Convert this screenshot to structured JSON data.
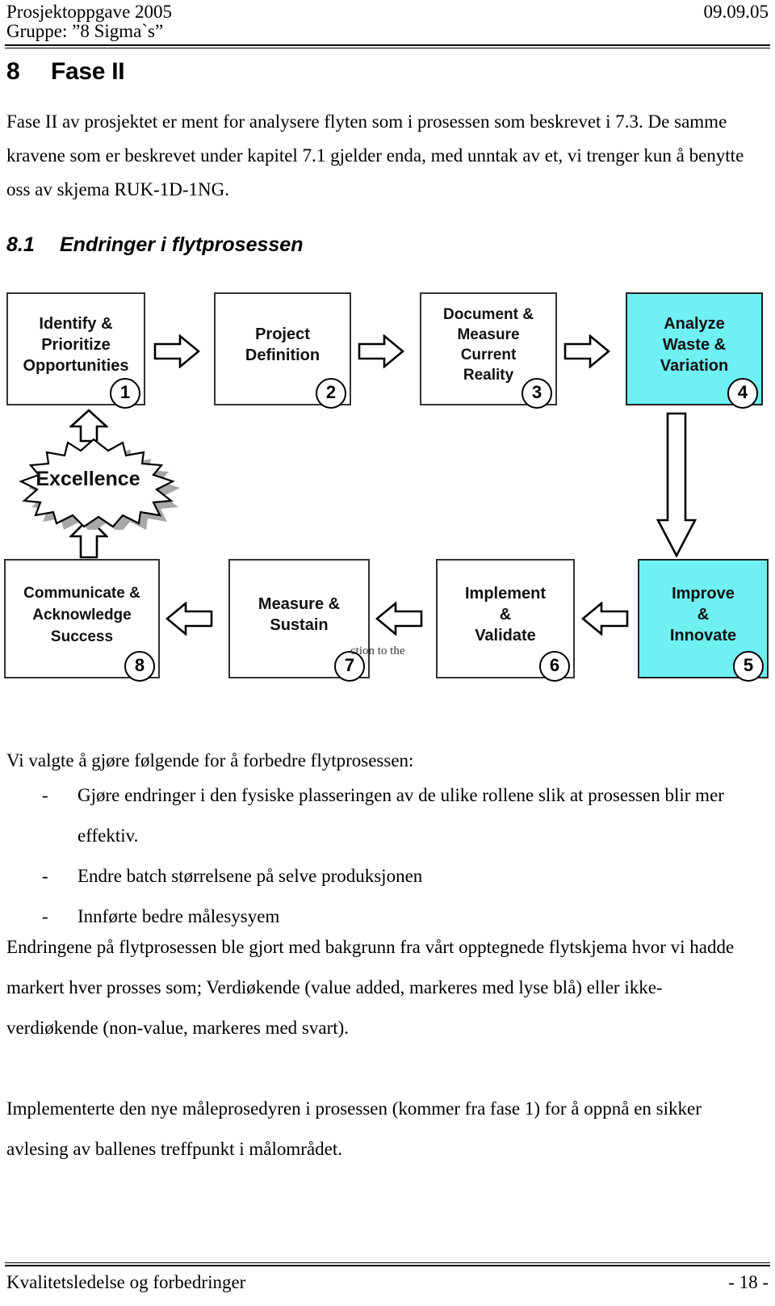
{
  "header": {
    "left_line1": "Prosjektoppgave 2005",
    "left_line2": "Gruppe: ”8 Sigma`s”",
    "right_date": "09.09.05"
  },
  "chapter": {
    "number": "8",
    "title": "Fase II"
  },
  "intro_paragraph": "Fase II av prosjektet er ment for analysere flyten som i prosessen som beskrevet i 7.3. De samme kravene som er beskrevet under kapitel 7.1 gjelder enda, med unntak av et, vi trenger kun å benytte oss av skjema RUK-1D-1NG.",
  "section": {
    "number": "8.1",
    "title": "Endringer i flytprosessen"
  },
  "diagram": {
    "name": "eight-step-improvement-cycle",
    "cyan_color": "#6ff0f3",
    "center_shape_label": "Excellence",
    "ghost_text": "ction to the",
    "boxes": [
      {
        "id": 1,
        "label": "Identify &\nPrioritize\nOpportunities",
        "badge": "1",
        "highlight": false
      },
      {
        "id": 2,
        "label": "Project\nDefinition",
        "badge": "2",
        "highlight": false
      },
      {
        "id": 3,
        "label": "Document &\nMeasure\nCurrent\nReality",
        "badge": "3",
        "highlight": false
      },
      {
        "id": 4,
        "label": "Analyze\nWaste &\nVariation",
        "badge": "4",
        "highlight": true
      },
      {
        "id": 5,
        "label": "Improve\n&\nInnovate",
        "badge": "5",
        "highlight": true
      },
      {
        "id": 6,
        "label": "Implement\n&\nValidate",
        "badge": "6",
        "highlight": false
      },
      {
        "id": 7,
        "label": "Measure &\nSustain",
        "badge": "7",
        "highlight": false
      },
      {
        "id": 8,
        "label": "Communicate &\nAcknowledge\nSuccess",
        "badge": "8",
        "highlight": false
      }
    ]
  },
  "list": {
    "lead_in": "Vi valgte å gjøre følgende for å forbedre flytprosessen:",
    "dash": "-",
    "items": [
      "Gjøre endringer i den fysiske plasseringen av de ulike rollene slik at prosessen blir mer effektiv.",
      "Endre batch størrelsene på selve produksjonen",
      "Innførte bedre målesysyem"
    ]
  },
  "paragraph_changes": "Endringene på flytprosessen ble gjort med bakgrunn fra vårt opptegnede flytskjema hvor vi hadde markert hver prosses som; Verdiøkende (value added, markeres med lyse blå) eller ikke- verdiøkende (non-value, markeres med svart).",
  "paragraph_implementation": "Implementerte den nye måleprosedyren i prosessen (kommer fra fase 1) for å oppnå en sikker avlesing av ballenes treffpunkt i målområdet.",
  "footer": {
    "left": "Kvalitetsledelse og forbedringer",
    "right": "- 18 -"
  }
}
